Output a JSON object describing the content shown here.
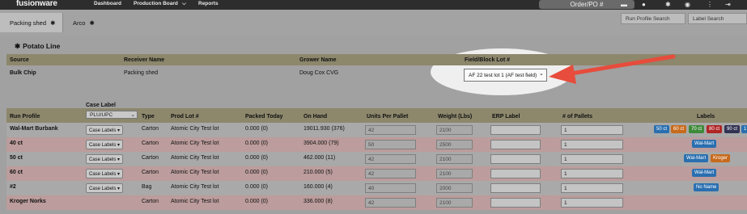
{
  "navbar": {
    "logo": "fusionware",
    "links": [
      "Dashboard",
      "Production Board",
      "Reports"
    ],
    "production_caret": "⌵",
    "order_po": "Order/PO #"
  },
  "tabs": [
    {
      "label": "Packing shed",
      "icon": "gear-icon"
    },
    {
      "label": "Arco",
      "icon": "gear-icon"
    }
  ],
  "search": {
    "run_profile_placeholder": "Run Profile Search",
    "label_placeholder": "Label Search"
  },
  "section": {
    "title": "Potato Line",
    "icon": "gear-icon"
  },
  "line_header": {
    "source": "Source",
    "receiver_name": "Receiver Name",
    "grower_name": "Grower Name",
    "field_block_lot": "Field/Block Lot #"
  },
  "line_row": {
    "source": "Bulk Chip",
    "receiver_name": "Packing shed",
    "grower_name": "Doug Cox CVG",
    "field_block_lot": "AF 22 test lot 1 (AF test field)"
  },
  "table_header": {
    "case_label": "Case Label",
    "case_label_select": "PLU/UPC",
    "run_profile": "Run Profile",
    "type": "Type",
    "prod_lot": "Prod Lot #",
    "packed_today": "Packed Today",
    "on_hand": "On Hand",
    "units_per_pallet": "Units Per Pallet",
    "weight": "Weight (Lbs)",
    "erp_label": "ERP Label",
    "num_pallets": "# of Pallets",
    "labels": "Labels"
  },
  "rows": [
    {
      "name": "Wal-Mart Burbank",
      "case_labels": "Case Labels ▾",
      "type": "Carton",
      "prod_lot": "Atomic City Test lot",
      "packed": "0.000 (0)",
      "on_hand": "19011.930 (376)",
      "units": "42",
      "weight": "2100",
      "erp": "",
      "pallets": "1"
    },
    {
      "name": "40 ct",
      "case_labels": "Case Labels ▾",
      "type": "Carton",
      "prod_lot": "Atomic City Test lot",
      "packed": "0.000 (0)",
      "on_hand": "3904.000 (79)",
      "units": "50",
      "weight": "2500",
      "erp": "",
      "pallets": "1"
    },
    {
      "name": "50 ct",
      "case_labels": "Case Labels ▾",
      "type": "Carton",
      "prod_lot": "Atomic City Test lot",
      "packed": "0.000 (0)",
      "on_hand": "462.000 (11)",
      "units": "42",
      "weight": "2100",
      "erp": "",
      "pallets": "1"
    },
    {
      "name": "60 ct",
      "case_labels": "Case Labels ▾",
      "type": "Carton",
      "prod_lot": "Atomic City Test lot",
      "packed": "0.000 (0)",
      "on_hand": "210.000 (5)",
      "units": "42",
      "weight": "2100",
      "erp": "",
      "pallets": "1"
    },
    {
      "name": "#2",
      "case_labels": "Case Labels ▾",
      "type": "Bag",
      "prod_lot": "Atomic City Test lot",
      "packed": "0.000 (0)",
      "on_hand": "160.000 (4)",
      "units": "40",
      "weight": "2000",
      "erp": "",
      "pallets": "1"
    },
    {
      "name": "Kroger Norks",
      "case_labels": "",
      "type": "Carton",
      "prod_lot": "Atomic City Test lot",
      "packed": "0.000 (0)",
      "on_hand": "336.000 (8)",
      "units": "42",
      "weight": "2100",
      "erp": "",
      "pallets": "1"
    }
  ],
  "row_labels": {
    "row0": [
      {
        "text": "50 ct",
        "color": "#2a6fb0"
      },
      {
        "text": "60 ct",
        "color": "#c76a1c"
      },
      {
        "text": "70 ct",
        "color": "#3f8a3a"
      },
      {
        "text": "80 ct",
        "color": "#b02525"
      },
      {
        "text": "90 ct",
        "color": "#333355"
      },
      {
        "text": "1",
        "color": "#2a6fb0"
      }
    ],
    "row1": [
      {
        "text": "Wal-Mart",
        "color": "#2a6fb0"
      }
    ],
    "row2": [
      {
        "text": "Wal-Mart",
        "color": "#2a6fb0"
      },
      {
        "text": "Kroger",
        "color": "#c76a1c"
      }
    ],
    "row3": [
      {
        "text": "Wal-Mart",
        "color": "#2a6fb0"
      }
    ],
    "row4": [
      {
        "text": "No Name",
        "color": "#2a6fb0"
      }
    ]
  },
  "colors": {
    "arrow": "#e74c3c",
    "header_band": "#8d876c",
    "pink_row": "#bc9c9c"
  }
}
